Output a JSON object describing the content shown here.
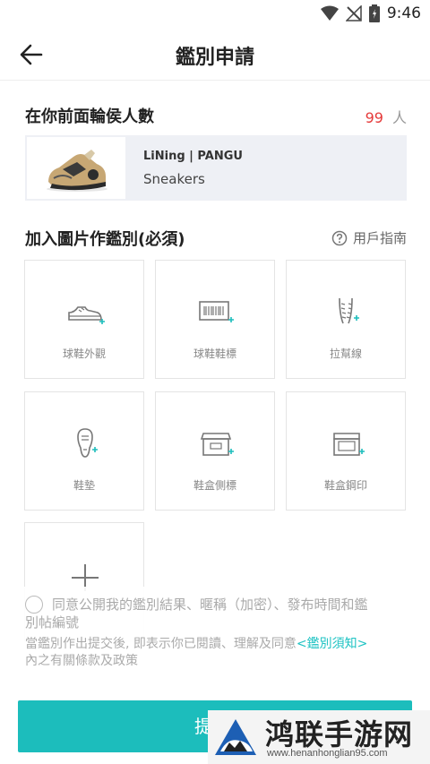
{
  "status_bar": {
    "time": "9:46",
    "icons": [
      "wifi-icon",
      "signal-off-icon",
      "battery-icon"
    ]
  },
  "header": {
    "title": "鑑別申請",
    "back_icon": "back-arrow-icon"
  },
  "queue": {
    "label": "在你前面輪侯人數",
    "count": "99",
    "unit": "人"
  },
  "product": {
    "brand": "LiNing | PANGU",
    "type": "Sneakers"
  },
  "photos_section": {
    "label": "加入圖片作鑑別(必須)",
    "guide": "用戶指南"
  },
  "photo_slots": [
    {
      "label": "球鞋外觀",
      "icon": "sneaker-icon"
    },
    {
      "label": "球鞋鞋標",
      "icon": "barcode-icon"
    },
    {
      "label": "拉幫線",
      "icon": "stitch-line-icon"
    },
    {
      "label": "鞋墊",
      "icon": "insole-icon"
    },
    {
      "label": "鞋盒側標",
      "icon": "shoebox-side-icon"
    },
    {
      "label": "鞋盒鋼印",
      "icon": "shoebox-stamp-icon"
    },
    {
      "label": "",
      "icon": "add-photo-icon"
    }
  ],
  "agreement": {
    "text_line1": "同意公開我的鑑別結果、暱稱（加密）、發布時間和鑑",
    "text_line2": "別帖編號",
    "notice_before": "當鑑別作出提交後, 即表示你已閱讀、理解及同意",
    "notice_link": "<鑑別須知>",
    "notice_after": "內之有關條款及政策"
  },
  "submit": {
    "label": "提"
  },
  "watermark": {
    "title": "鸿联手游网",
    "url": "www.henanhonglian95.com"
  },
  "colors": {
    "accent": "#1cbdbc",
    "count_red": "#e53a3a"
  }
}
